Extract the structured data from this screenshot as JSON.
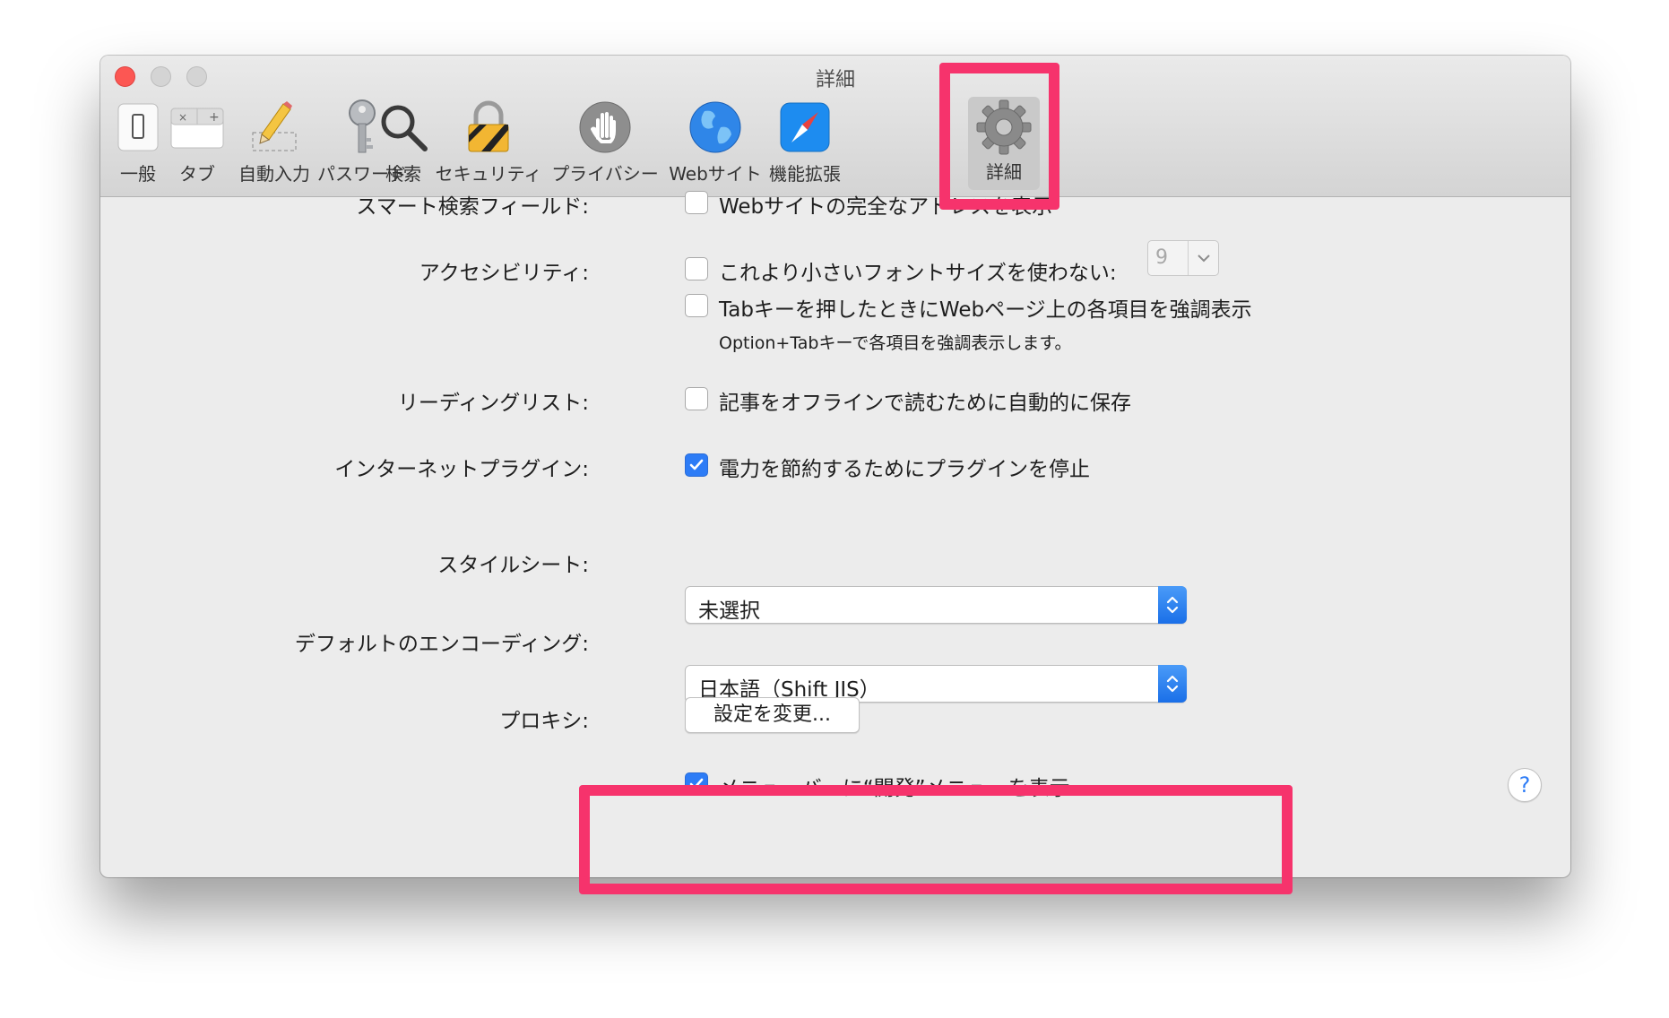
{
  "window": {
    "title": "詳細"
  },
  "toolbar": {
    "items": [
      {
        "label": "一般",
        "icon": "general-switch-icon"
      },
      {
        "label": "タブ",
        "icon": "tabs-icon"
      },
      {
        "label": "自動入力",
        "icon": "autofill-pencil-icon"
      },
      {
        "label": "パスワード",
        "icon": "key-icon"
      },
      {
        "label": "検索",
        "icon": "magnifier-icon"
      },
      {
        "label": "セキュリティ",
        "icon": "lock-icon"
      },
      {
        "label": "プライバシー",
        "icon": "hand-icon"
      },
      {
        "label": "Webサイト",
        "icon": "globe-icon"
      },
      {
        "label": "機能拡張",
        "icon": "compass-icon"
      },
      {
        "label": "詳細",
        "icon": "gear-icon",
        "selected": true
      }
    ]
  },
  "settings": {
    "smart_search": {
      "label": "スマート検索フィールド:",
      "option": "Webサイトの完全なアドレスを表示",
      "checked": false
    },
    "accessibility": {
      "label": "アクセシビリティ:",
      "option_min_font": "これより小さいフォントサイズを使わない:",
      "min_font_checked": false,
      "min_font_value": "9",
      "option_tab": "Tabキーを押したときにWebページ上の各項目を強調表示",
      "tab_checked": false,
      "note": "Option+Tabキーで各項目を強調表示します。"
    },
    "reading_list": {
      "label": "リーディングリスト:",
      "option": "記事をオフラインで読むために自動的に保存",
      "checked": false
    },
    "plugins": {
      "label": "インターネットプラグイン:",
      "option": "電力を節約するためにプラグインを停止",
      "checked": true
    },
    "stylesheet": {
      "label": "スタイルシート:",
      "value": "未選択"
    },
    "encoding": {
      "label": "デフォルトのエンコーディング:",
      "value": "日本語（Shift JIS）"
    },
    "proxy": {
      "label": "プロキシ:",
      "button": "設定を変更..."
    },
    "develop_menu": {
      "option": "メニューバーに“開発”メニューを表示",
      "checked": true
    }
  },
  "help_button": "?",
  "colors": {
    "accent": "#2d7cf6",
    "highlight": "#f6336c",
    "close": "#fc5753"
  }
}
